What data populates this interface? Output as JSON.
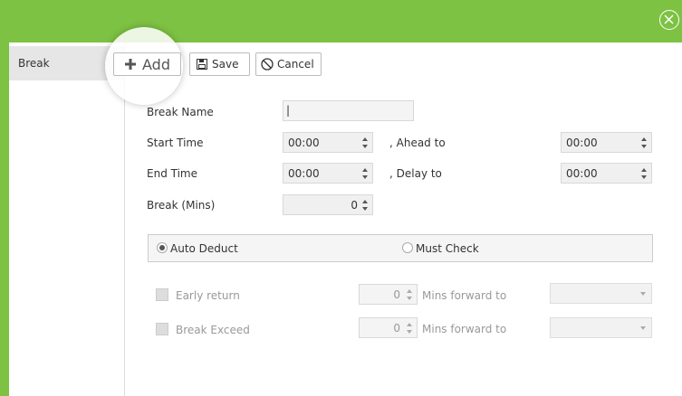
{
  "sidebar": {
    "items": [
      {
        "label": "Break"
      }
    ]
  },
  "toolbar": {
    "add_label": "Add",
    "save_label": "Save",
    "cancel_label": "Cancel"
  },
  "form": {
    "break_name_label": "Break Name",
    "break_name_value": "|",
    "start_time_label": "Start Time",
    "start_time_value": "00:00",
    "ahead_to_label": ", Ahead to",
    "ahead_to_value": "00:00",
    "end_time_label": "End Time",
    "end_time_value": "00:00",
    "delay_to_label": ", Delay to",
    "delay_to_value": "00:00",
    "break_mins_label": "Break (Mins)",
    "break_mins_value": "0",
    "radio_auto_label": "Auto Deduct",
    "radio_must_label": "Must Check",
    "early_return_label": "Early return",
    "early_return_value": "0",
    "early_forward_label": "Mins forward to",
    "break_exceed_label": "Break Exceed",
    "break_exceed_value": "0",
    "exceed_forward_label": "Mins forward to"
  },
  "colors": {
    "accent": "#7dc243"
  },
  "icons": {
    "close": "close-circle-icon",
    "add": "plus-icon",
    "save": "floppy-icon",
    "cancel": "cancel-circle-icon"
  }
}
